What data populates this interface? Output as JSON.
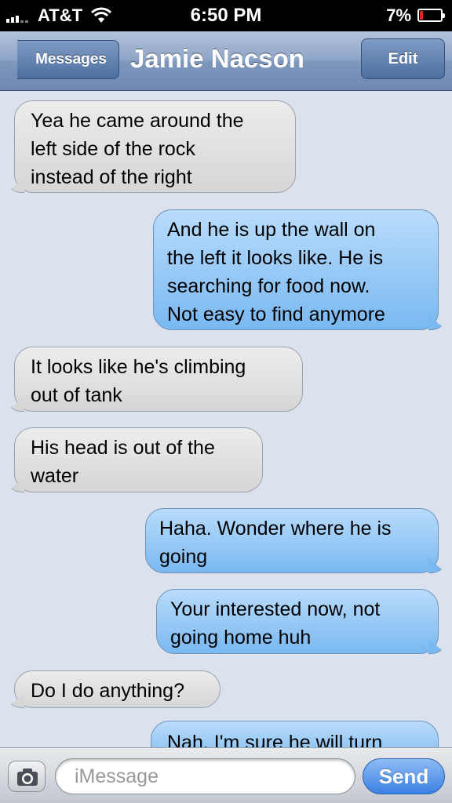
{
  "status_bar": {
    "carrier": "AT&T",
    "time": "6:50 PM",
    "battery_percent": "7%",
    "battery_level": 0.07,
    "signal_icon": "signal-bars-icon",
    "wifi_icon": "wifi-icon",
    "battery_icon": "battery-icon"
  },
  "nav": {
    "back_label": "Messages",
    "title": "Jamie Nacson",
    "edit_label": "Edit"
  },
  "messages": [
    {
      "direction": "incoming",
      "lines": [
        "Yea he came around the",
        "left side of the rock",
        "instead of the right"
      ]
    },
    {
      "direction": "outgoing",
      "lines": [
        "And he is up the wall on",
        "the left it looks like. He is",
        "searching for food now.",
        "Not easy to find anymore"
      ]
    },
    {
      "direction": "incoming",
      "lines": [
        "It looks like he's climbing",
        "out of tank"
      ]
    },
    {
      "direction": "incoming",
      "lines": [
        "His head is out of the",
        "water"
      ]
    },
    {
      "direction": "outgoing",
      "lines": [
        "Haha. Wonder where he is",
        "going"
      ]
    },
    {
      "direction": "outgoing",
      "lines": [
        "Your interested now, not",
        "going home huh"
      ]
    },
    {
      "direction": "incoming",
      "lines": [
        "Do I do anything?"
      ]
    },
    {
      "direction": "outgoing",
      "lines": [
        "Nah. I'm sure he will turn"
      ]
    }
  ],
  "input_bar": {
    "camera_icon": "camera-icon",
    "placeholder": "iMessage",
    "send_label": "Send"
  },
  "colors": {
    "incoming_bubble": "#dcdcdc",
    "outgoing_bubble": "#8ec6f5",
    "background": "#dbe2ed",
    "nav_bar": "#7d97bd",
    "send_button": "#3b80e2"
  }
}
